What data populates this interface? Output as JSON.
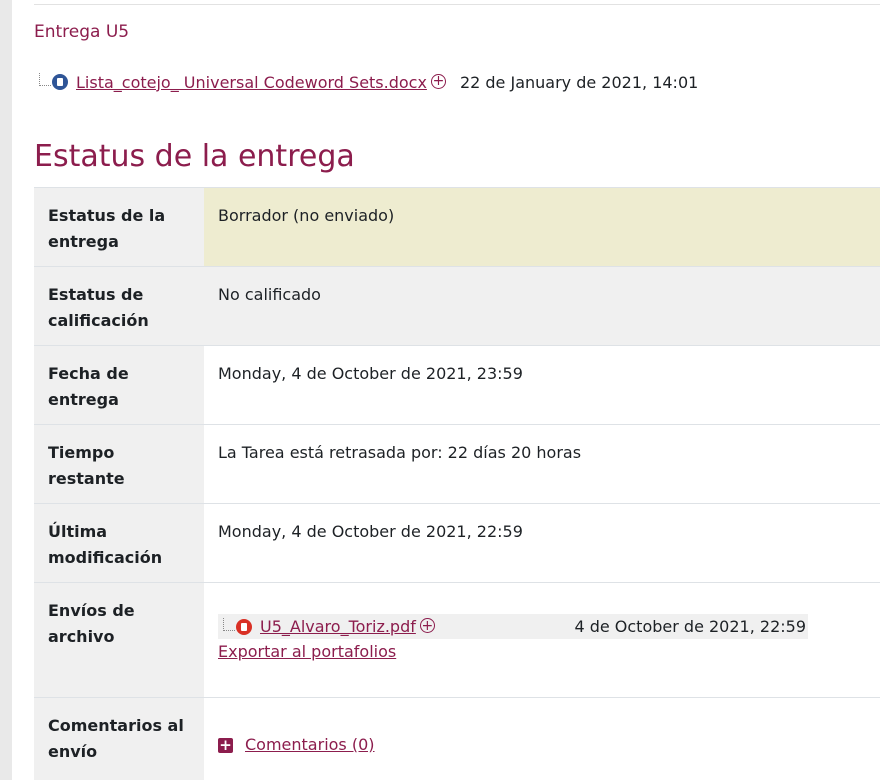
{
  "intro": {
    "title": "Entrega U5"
  },
  "attached_file": {
    "name": "Lista_cotejo_ Universal Codeword Sets.docx",
    "date": "22 de January de 2021, 14:01",
    "icon": "docx-icon"
  },
  "status_section": {
    "title": "Estatus de la entrega"
  },
  "rows": [
    {
      "label": "Estatus de la entrega",
      "value": "Borrador (no enviado)"
    },
    {
      "label": "Estatus de calificación",
      "value": "No calificado"
    },
    {
      "label": "Fecha de entrega",
      "value": "Monday, 4 de October de 2021, 23:59"
    },
    {
      "label": "Tiempo restante",
      "value": "La Tarea está retrasada por: 22 días 20 horas"
    },
    {
      "label": "Última modificación",
      "value": "Monday, 4 de October de 2021, 22:59"
    },
    {
      "label": "Envíos de archivo",
      "file_name": "U5_Alvaro_Toriz.pdf",
      "file_date": "4 de October de 2021, 22:59",
      "export_label": "Exportar al portafolios"
    },
    {
      "label": "Comentarios al envío",
      "comments_label": "Comentarios (0)"
    }
  ],
  "colors": {
    "accent": "#8c1d4d",
    "late_text": "#e02020",
    "draft_row": "#eeecd0"
  }
}
